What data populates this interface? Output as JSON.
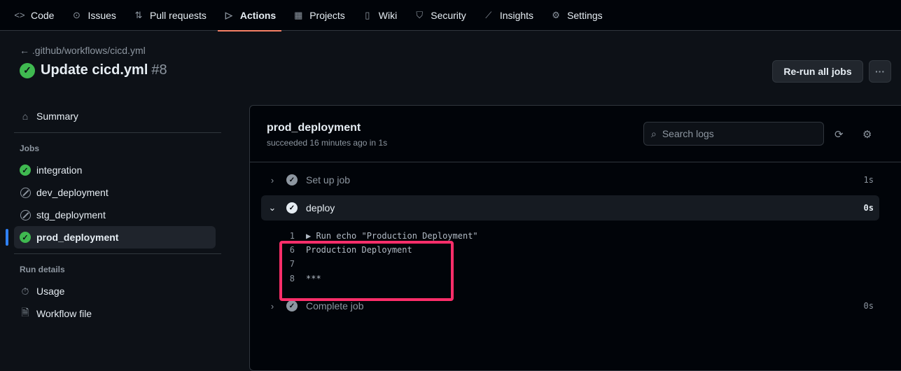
{
  "nav": {
    "tabs": [
      {
        "label": "Code",
        "icon": "code-icon",
        "glyph": "<>"
      },
      {
        "label": "Issues",
        "icon": "issue-icon",
        "glyph": "⊙"
      },
      {
        "label": "Pull requests",
        "icon": "pull-request-icon",
        "glyph": "⇅"
      },
      {
        "label": "Actions",
        "icon": "play-icon",
        "glyph": "▷"
      },
      {
        "label": "Projects",
        "icon": "table-icon",
        "glyph": "▦"
      },
      {
        "label": "Wiki",
        "icon": "book-icon",
        "glyph": "📖"
      },
      {
        "label": "Security",
        "icon": "shield-icon",
        "glyph": "⛉"
      },
      {
        "label": "Insights",
        "icon": "graph-icon",
        "glyph": "⟋"
      },
      {
        "label": "Settings",
        "icon": "gear-icon",
        "glyph": "⚙"
      }
    ],
    "active": "Actions"
  },
  "header": {
    "back": "← .github/workflows/cicd.yml",
    "title": "Update cicd.yml",
    "run_number": "#8",
    "rerun_label": "Re-run all jobs",
    "more_label": "···"
  },
  "sidebar": {
    "summary": "Summary",
    "jobs_heading": "Jobs",
    "jobs": [
      {
        "name": "integration",
        "status": "success"
      },
      {
        "name": "dev_deployment",
        "status": "skipped"
      },
      {
        "name": "stg_deployment",
        "status": "skipped"
      },
      {
        "name": "prod_deployment",
        "status": "success"
      }
    ],
    "run_details_heading": "Run details",
    "usage": "Usage",
    "workflow_file": "Workflow file"
  },
  "job": {
    "name": "prod_deployment",
    "status": "succeeded 16 minutes ago in 1s",
    "search_placeholder": "Search logs",
    "steps": [
      {
        "label": "Set up job",
        "time": "1s"
      },
      {
        "label": "deploy",
        "time": "0s"
      },
      {
        "label": "Complete job",
        "time": "0s"
      }
    ],
    "log": [
      {
        "n": "1",
        "text": "▶ Run echo \"Production Deployment\""
      },
      {
        "n": "6",
        "text": "Production Deployment"
      },
      {
        "n": "7",
        "text": ""
      },
      {
        "n": "8",
        "text": "***"
      }
    ]
  },
  "colors": {
    "success": "#3fb950",
    "accent": "#f78166",
    "highlight": "#ff2e6a"
  }
}
